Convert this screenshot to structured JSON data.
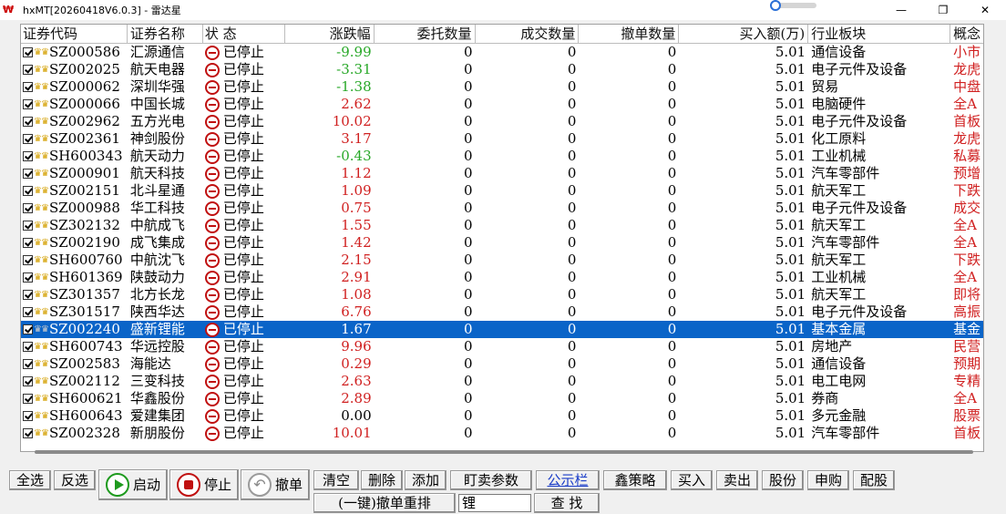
{
  "window": {
    "title": "hxMT[20260418V6.0.3] - 雷达星",
    "app_icon": "₩",
    "minimize_glyph": "—",
    "maximize_glyph": "❐",
    "close_glyph": "✕"
  },
  "columns": {
    "code": "证券代码",
    "name": "证券名称",
    "status": "状    态",
    "change": "涨跌幅",
    "entrust_qty": "委托数量",
    "deal_qty": "成交数量",
    "cancel_qty": "撤单数量",
    "buy_amount": "买入额(万)",
    "industry": "行业板块",
    "concept": "概念"
  },
  "rows": [
    {
      "code": "SZ000586",
      "name": "汇源通信",
      "status": "已停止",
      "change": "-9.99",
      "entrust": "0",
      "deal": "0",
      "cancel": "0",
      "buy": "5.01",
      "industry": "通信设备",
      "concept": "小市"
    },
    {
      "code": "SZ002025",
      "name": "航天电器",
      "status": "已停止",
      "change": "-3.31",
      "entrust": "0",
      "deal": "0",
      "cancel": "0",
      "buy": "5.01",
      "industry": "电子元件及设备",
      "concept": "龙虎"
    },
    {
      "code": "SZ000062",
      "name": "深圳华强",
      "status": "已停止",
      "change": "-1.38",
      "entrust": "0",
      "deal": "0",
      "cancel": "0",
      "buy": "5.01",
      "industry": "贸易",
      "concept": "中盘"
    },
    {
      "code": "SZ000066",
      "name": "中国长城",
      "status": "已停止",
      "change": "2.62",
      "entrust": "0",
      "deal": "0",
      "cancel": "0",
      "buy": "5.01",
      "industry": "电脑硬件",
      "concept": "全A"
    },
    {
      "code": "SZ002962",
      "name": "五方光电",
      "status": "已停止",
      "change": "10.02",
      "entrust": "0",
      "deal": "0",
      "cancel": "0",
      "buy": "5.01",
      "industry": "电子元件及设备",
      "concept": "首板"
    },
    {
      "code": "SZ002361",
      "name": "神剑股份",
      "status": "已停止",
      "change": "3.17",
      "entrust": "0",
      "deal": "0",
      "cancel": "0",
      "buy": "5.01",
      "industry": "化工原料",
      "concept": "龙虎"
    },
    {
      "code": "SH600343",
      "name": "航天动力",
      "status": "已停止",
      "change": "-0.43",
      "entrust": "0",
      "deal": "0",
      "cancel": "0",
      "buy": "5.01",
      "industry": "工业机械",
      "concept": "私募"
    },
    {
      "code": "SZ000901",
      "name": "航天科技",
      "status": "已停止",
      "change": "1.12",
      "entrust": "0",
      "deal": "0",
      "cancel": "0",
      "buy": "5.01",
      "industry": "汽车零部件",
      "concept": "预增"
    },
    {
      "code": "SZ002151",
      "name": "北斗星通",
      "status": "已停止",
      "change": "1.09",
      "entrust": "0",
      "deal": "0",
      "cancel": "0",
      "buy": "5.01",
      "industry": "航天军工",
      "concept": "下跌"
    },
    {
      "code": "SZ000988",
      "name": "华工科技",
      "status": "已停止",
      "change": "0.75",
      "entrust": "0",
      "deal": "0",
      "cancel": "0",
      "buy": "5.01",
      "industry": "电子元件及设备",
      "concept": "成交"
    },
    {
      "code": "SZ302132",
      "name": "中航成飞",
      "status": "已停止",
      "change": "1.55",
      "entrust": "0",
      "deal": "0",
      "cancel": "0",
      "buy": "5.01",
      "industry": "航天军工",
      "concept": "全A"
    },
    {
      "code": "SZ002190",
      "name": "成飞集成",
      "status": "已停止",
      "change": "1.42",
      "entrust": "0",
      "deal": "0",
      "cancel": "0",
      "buy": "5.01",
      "industry": "汽车零部件",
      "concept": "全A"
    },
    {
      "code": "SH600760",
      "name": "中航沈飞",
      "status": "已停止",
      "change": "2.15",
      "entrust": "0",
      "deal": "0",
      "cancel": "0",
      "buy": "5.01",
      "industry": "航天军工",
      "concept": "下跌"
    },
    {
      "code": "SH601369",
      "name": "陕鼓动力",
      "status": "已停止",
      "change": "2.91",
      "entrust": "0",
      "deal": "0",
      "cancel": "0",
      "buy": "5.01",
      "industry": "工业机械",
      "concept": "全A"
    },
    {
      "code": "SZ301357",
      "name": "北方长龙",
      "status": "已停止",
      "change": "1.08",
      "entrust": "0",
      "deal": "0",
      "cancel": "0",
      "buy": "5.01",
      "industry": "航天军工",
      "concept": "即将"
    },
    {
      "code": "SZ301517",
      "name": "陕西华达",
      "status": "已停止",
      "change": "6.76",
      "entrust": "0",
      "deal": "0",
      "cancel": "0",
      "buy": "5.01",
      "industry": "电子元件及设备",
      "concept": "高振"
    },
    {
      "code": "SZ002240",
      "name": "盛新锂能",
      "status": "已停止",
      "change": "1.67",
      "entrust": "0",
      "deal": "0",
      "cancel": "0",
      "buy": "5.01",
      "industry": "基本金属",
      "concept": "基金",
      "selected": true
    },
    {
      "code": "SH600743",
      "name": "华远控股",
      "status": "已停止",
      "change": "9.96",
      "entrust": "0",
      "deal": "0",
      "cancel": "0",
      "buy": "5.01",
      "industry": "房地产",
      "concept": "民营"
    },
    {
      "code": "SZ002583",
      "name": "海能达",
      "status": "已停止",
      "change": "0.29",
      "entrust": "0",
      "deal": "0",
      "cancel": "0",
      "buy": "5.01",
      "industry": "通信设备",
      "concept": "预期"
    },
    {
      "code": "SZ002112",
      "name": "三变科技",
      "status": "已停止",
      "change": "2.63",
      "entrust": "0",
      "deal": "0",
      "cancel": "0",
      "buy": "5.01",
      "industry": "电工电网",
      "concept": "专精"
    },
    {
      "code": "SH600621",
      "name": "华鑫股份",
      "status": "已停止",
      "change": "2.89",
      "entrust": "0",
      "deal": "0",
      "cancel": "0",
      "buy": "5.01",
      "industry": "券商",
      "concept": "全A"
    },
    {
      "code": "SH600643",
      "name": "爱建集团",
      "status": "已停止",
      "change": "0.00",
      "entrust": "0",
      "deal": "0",
      "cancel": "0",
      "buy": "5.01",
      "industry": "多元金融",
      "concept": "股票"
    },
    {
      "code": "SZ002328",
      "name": "新朋股份",
      "status": "已停止",
      "change": "10.01",
      "entrust": "0",
      "deal": "0",
      "cancel": "0",
      "buy": "5.01",
      "industry": "汽车零部件",
      "concept": "首板"
    }
  ],
  "toolbar": {
    "select_all": "全选",
    "invert": "反选",
    "start": "启动",
    "stop": "停止",
    "cancel_order": "撤单",
    "clear": "清空",
    "delete": "删除",
    "add": "添加",
    "watch_params": "盯卖参数",
    "bulletin": "公示栏",
    "strategy": "鑫策略",
    "buy": "买入",
    "sell": "卖出",
    "position": "股份",
    "subscribe": "申购",
    "allot": "配股",
    "one_key_cancel": "(一键)撤单重排",
    "search_value": "锂",
    "search": "查 找"
  },
  "colors": {
    "up": "#d02020",
    "down": "#28a828",
    "selected_row": "#0a64c8",
    "link": "#1a3cc8"
  },
  "icons": {
    "row_check": "checkbox-checked-icon",
    "row_crown": "crown-icon",
    "row_status": "stop-circle-icon",
    "start": "play-circle-icon",
    "stop": "stop-square-icon",
    "cancel": "undo-arrow-icon"
  }
}
